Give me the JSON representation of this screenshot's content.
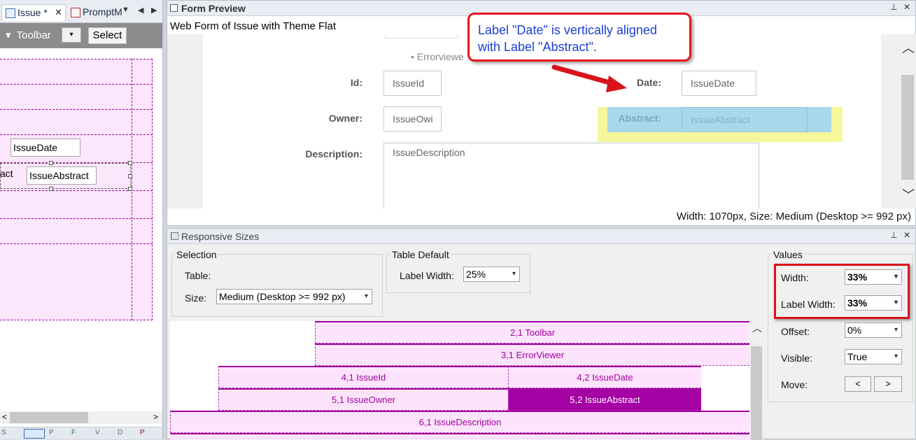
{
  "left": {
    "tabs": [
      {
        "label": "Issue *",
        "close": "✕"
      },
      {
        "label": "PromptM"
      }
    ],
    "strip_arrows": [
      "▼",
      "◀",
      "▶"
    ],
    "toolbar": {
      "label": "Toolbar",
      "arrow": "▾",
      "dropdown_arrow": "▾",
      "select_button": "Select"
    },
    "fields": {
      "date": "IssueDate",
      "abstract_label": "act",
      "abstract": "IssueAbstract"
    },
    "bottom_icons": [
      "S",
      "P",
      "F",
      "V",
      "D",
      "P"
    ]
  },
  "preview": {
    "title": "Form Preview",
    "subtitle": "Web Form of Issue with Theme Flat",
    "errorviewer": "• Errorviewe",
    "labels": {
      "id": "Id:",
      "owner": "Owner:",
      "description": "Description:",
      "date": "Date:",
      "abstract": "Abstract:"
    },
    "inputs": {
      "id": "IssueId",
      "owner": "IssueOwi",
      "description": "IssueDescription",
      "date": "IssueDate",
      "abstract": "IssueAbstract"
    },
    "status": "Width: 1070px, Size: Medium (Desktop >= 992 px)",
    "callout": "Label \"Date\" is vertically aligned with Label \"Abstract\".",
    "scroll_up": "︿",
    "scroll_down": "﹀",
    "pin": "⊥",
    "close": "✕"
  },
  "responsive": {
    "title": "Responsive Sizes",
    "selection": {
      "group": "Selection",
      "table_label": "Table:",
      "size_label": "Size:",
      "size_value": "Medium (Desktop >= 992 px)"
    },
    "table_default": {
      "group": "Table Default",
      "label_width_label": "Label Width:",
      "label_width_value": "25%"
    },
    "values": {
      "group": "Values",
      "width_label": "Width:",
      "width_value": "33%",
      "label_width_label": "Label Width:",
      "label_width_value": "33%",
      "offset_label": "Offset:",
      "offset_value": "0%",
      "visible_label": "Visible:",
      "visible_value": "True",
      "move_label": "Move:",
      "move_left": "<",
      "move_right": ">"
    },
    "grid": [
      {
        "cell": "2,1 Toolbar"
      },
      {
        "cell": "3,1 ErrorViewer"
      },
      {
        "cell": "4,1 IssueId"
      },
      {
        "cell": "4,2 IssueDate"
      },
      {
        "cell": "5,1 IssueOwner"
      },
      {
        "cell": "5,2 IssueAbstract",
        "selected": true
      },
      {
        "cell": "6,1 IssueDescription"
      }
    ],
    "scroll_up": "︿",
    "dropdown_arrow": "▾",
    "pin": "⊥",
    "close": "✕"
  }
}
